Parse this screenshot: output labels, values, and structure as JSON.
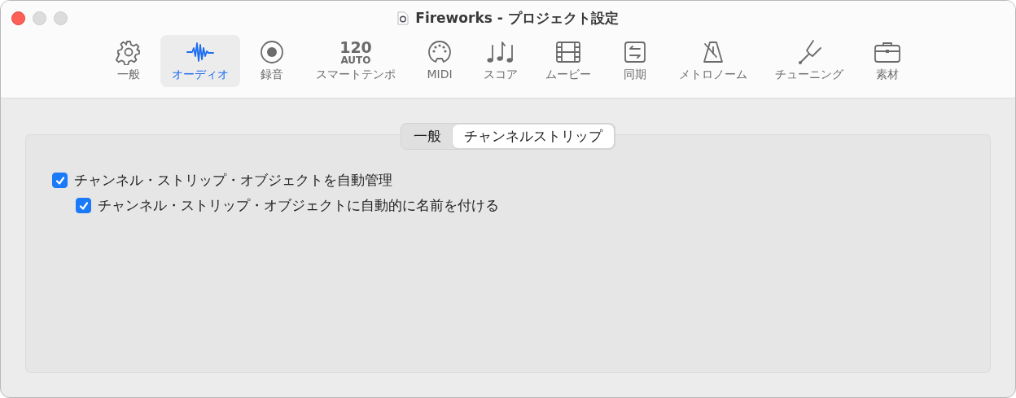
{
  "window": {
    "title": "Fireworks - プロジェクト設定"
  },
  "toolbar": [
    {
      "kind": "gear",
      "label": "一般",
      "selected": false
    },
    {
      "kind": "waveform",
      "label": "オーディオ",
      "selected": true
    },
    {
      "kind": "record",
      "label": "録音",
      "selected": false
    },
    {
      "kind": "tempo",
      "icon_text": [
        "120",
        "AUTO"
      ],
      "label": "スマートテンポ",
      "selected": false
    },
    {
      "kind": "midi",
      "label": "MIDI",
      "selected": false
    },
    {
      "kind": "notes",
      "label": "スコア",
      "selected": false
    },
    {
      "kind": "film",
      "label": "ムービー",
      "selected": false
    },
    {
      "kind": "sync",
      "label": "同期",
      "selected": false
    },
    {
      "kind": "metronome",
      "label": "メトロノーム",
      "selected": false
    },
    {
      "kind": "fork",
      "label": "チューニング",
      "selected": false
    },
    {
      "kind": "briefcase",
      "label": "素材",
      "selected": false
    }
  ],
  "tabs": [
    {
      "label": "一般",
      "selected": false
    },
    {
      "label": "チャンネルストリップ",
      "selected": true
    }
  ],
  "options": [
    {
      "label": "チャンネル・ストリップ・オブジェクトを自動管理",
      "checked": true,
      "children": [
        {
          "label": "チャンネル・ストリップ・オブジェクトに自動的に名前を付ける",
          "checked": true
        }
      ]
    }
  ]
}
